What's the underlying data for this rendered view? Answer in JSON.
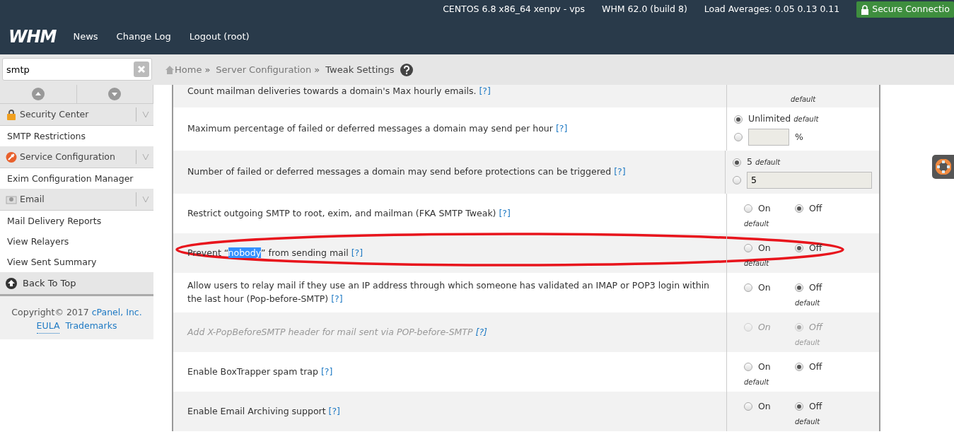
{
  "topbar": {
    "info": [
      "CENTOS 6.8 x86_64 xenpv - vps",
      "WHM 62.0 (build 8)",
      "Load Averages: 0.05 0.13 0.11"
    ],
    "secure": "Secure Connectio"
  },
  "header": {
    "logo": "WHM",
    "nav": [
      "News",
      "Change Log",
      "Logout (root)"
    ]
  },
  "sidebar": {
    "search": "smtp",
    "groups": [
      {
        "title": "Security Center",
        "items": [
          "SMTP Restrictions"
        ]
      },
      {
        "title": "Service Configuration",
        "items": [
          "Exim Configuration Manager"
        ]
      },
      {
        "title": "Email",
        "items": [
          "Mail Delivery Reports",
          "View Relayers",
          "View Sent Summary"
        ]
      }
    ],
    "back_to_top": "Back To Top",
    "footer": {
      "copyright": "Copyright© 2017",
      "company": "cPanel, Inc.",
      "links": [
        "EULA",
        "Trademarks"
      ]
    }
  },
  "breadcrumb": [
    {
      "kind": "link",
      "text": "Home"
    },
    {
      "kind": "sep",
      "text": "»"
    },
    {
      "kind": "link",
      "text": "Server Configuration"
    },
    {
      "kind": "sep",
      "text": "»"
    },
    {
      "kind": "current",
      "text": "Tweak Settings"
    }
  ],
  "rows": [
    {
      "kind": "cut",
      "label": "Count mailman deliveries towards a domain's Max hourly emails.",
      "help": "[?]",
      "default_label": "default",
      "disabled": false,
      "circled": false
    },
    {
      "kind": "choice",
      "label": "Maximum percentage of failed or deferred messages a domain may send per hour",
      "help": "[?]",
      "default_label": "default",
      "disabled": false,
      "circled": false,
      "options": [
        {
          "kind": "text",
          "label": "Unlimited",
          "selected": true,
          "is_default": true
        },
        {
          "kind": "input",
          "suffix": "%",
          "selected": false,
          "is_default": false
        }
      ]
    },
    {
      "kind": "choice",
      "label": "Number of failed or deferred messages a domain may send before protections can be triggered",
      "help": "[?]",
      "default_label": "default",
      "disabled": false,
      "circled": false,
      "options": [
        {
          "kind": "text",
          "label": "5",
          "selected": true,
          "is_default": true
        },
        {
          "kind": "input",
          "value": "5",
          "selected": false,
          "is_default": false
        }
      ]
    },
    {
      "kind": "toggle",
      "label": "Restrict outgoing SMTP to root, exim, and mailman (FKA SMTP Tweak)",
      "help": "[?]",
      "default_label": "default",
      "disabled": false,
      "circled": false,
      "options": [
        {
          "kind": "text",
          "label": "On",
          "selected": false,
          "is_default": true
        },
        {
          "kind": "text",
          "label": "Off",
          "selected": true,
          "is_default": false
        }
      ]
    },
    {
      "kind": "toggle",
      "label_parts": [
        {
          "text": "Prevent “",
          "selected": false
        },
        {
          "text": "nobody",
          "selected": true
        },
        {
          "text": "” from sending mail",
          "selected": false
        }
      ],
      "help": "[?]",
      "default_label": "default",
      "disabled": false,
      "circled": true,
      "options": [
        {
          "kind": "text",
          "label": "On",
          "selected": false,
          "is_default": true
        },
        {
          "kind": "text",
          "label": "Off",
          "selected": true,
          "is_default": false
        }
      ]
    },
    {
      "kind": "toggle",
      "label": "Allow users to relay mail if they use an IP address through which someone has validated an IMAP or POP3 login within the last hour (Pop-before-SMTP)",
      "help": "[?]",
      "default_label": "default",
      "disabled": false,
      "circled": false,
      "options": [
        {
          "kind": "text",
          "label": "On",
          "selected": false,
          "is_default": false
        },
        {
          "kind": "text",
          "label": "Off",
          "selected": true,
          "is_default": true
        }
      ]
    },
    {
      "kind": "toggle",
      "label": "Add X-PopBeforeSMTP header for mail sent via POP-before-SMTP",
      "help": "[?]",
      "default_label": "default",
      "disabled": true,
      "circled": false,
      "options": [
        {
          "kind": "text",
          "label": "On",
          "selected": false,
          "is_default": false
        },
        {
          "kind": "text",
          "label": "Off",
          "selected": true,
          "is_default": true
        }
      ]
    },
    {
      "kind": "toggle",
      "label": "Enable BoxTrapper spam trap",
      "help": "[?]",
      "default_label": "default",
      "disabled": false,
      "circled": false,
      "options": [
        {
          "kind": "text",
          "label": "On",
          "selected": false,
          "is_default": true
        },
        {
          "kind": "text",
          "label": "Off",
          "selected": true,
          "is_default": false
        }
      ]
    },
    {
      "kind": "toggle",
      "label": "Enable Email Archiving support",
      "help": "[?]",
      "default_label": "default",
      "disabled": false,
      "circled": false,
      "options": [
        {
          "kind": "text",
          "label": "On",
          "selected": false,
          "is_default": false
        },
        {
          "kind": "text",
          "label": "Off",
          "selected": true,
          "is_default": true
        }
      ]
    }
  ]
}
